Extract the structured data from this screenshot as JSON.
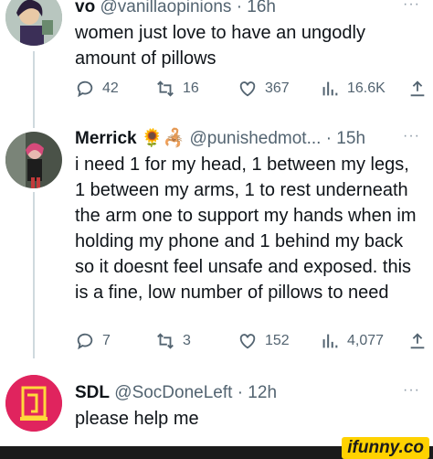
{
  "tweets": [
    {
      "name": "vo",
      "handle": "@vanillaopinions",
      "time": "· 16h",
      "text": "women just love to have an ungodly amount of pillows",
      "replies": "42",
      "retweets": "16",
      "likes": "367",
      "views": "16.6K"
    },
    {
      "name": "Merrick",
      "emoji": "🌻🦂",
      "handle": "@punishedmot...",
      "time": "· 15h",
      "text": "i need 1 for my head, 1 between my legs, 1 between my arms, 1 to rest underneath the arm one to support my hands when im holding my phone and 1 behind my back so it doesnt feel unsafe and exposed. this is a fine, low number of pillows to need",
      "replies": "7",
      "retweets": "3",
      "likes": "152",
      "views": "4,077"
    },
    {
      "name": "SDL",
      "handle": "@SocDoneLeft",
      "time": "· 12h",
      "text": "please help me"
    }
  ],
  "more_label": "···",
  "watermark": "ifunny.co",
  "colors": {
    "text": "#0f1419",
    "muted": "#536471",
    "line": "#cfd9de",
    "avatar3": "#e0245e",
    "watermark_bg": "#ffd200"
  }
}
